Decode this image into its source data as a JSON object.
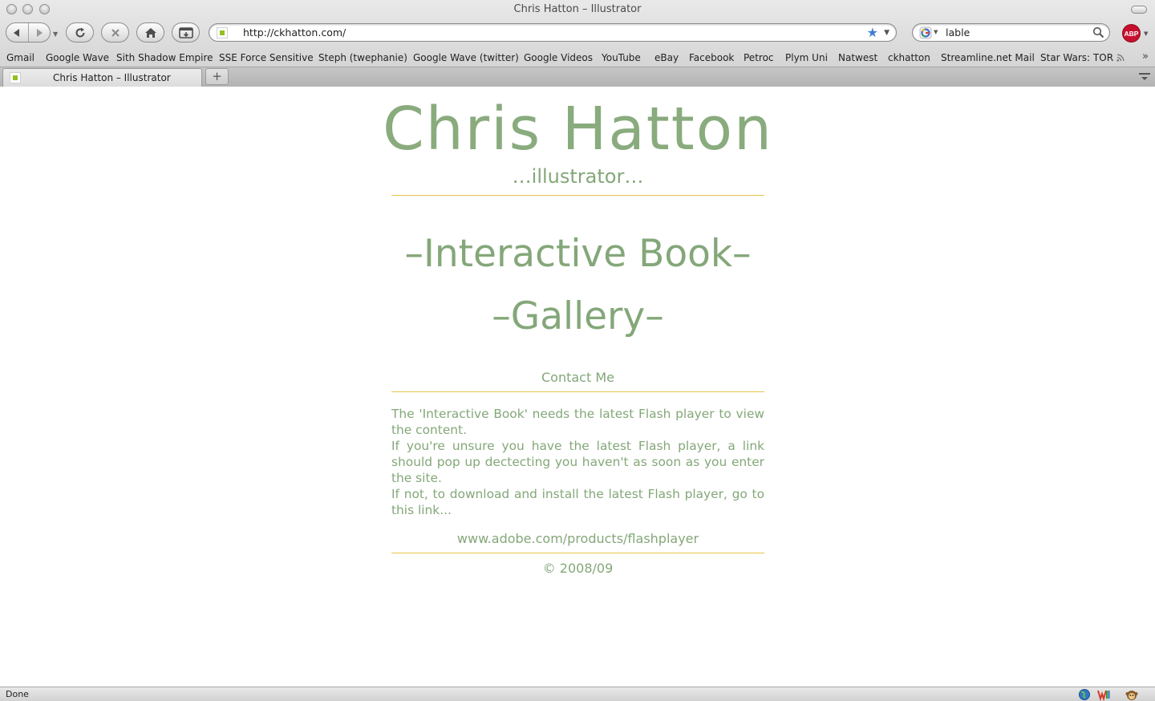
{
  "window": {
    "title": "Chris Hatton – Illustrator"
  },
  "navbar": {
    "url": "http://ckhatton.com/",
    "search_query": "lable"
  },
  "bookmarks": [
    "Gmail",
    "Google Wave",
    "Sith Shadow Empire",
    "SSE Force Sensitive",
    "Steph (twephanie)",
    "Google Wave (twitter)",
    "Google Videos",
    "YouTube",
    "eBay",
    "Facebook",
    "Petroc",
    "Plym Uni",
    "Natwest",
    "ckhatton",
    "Streamline.net Mail",
    "Star Wars: TOR"
  ],
  "tabs": [
    {
      "title": "Chris Hatton – Illustrator",
      "active": true
    }
  ],
  "page": {
    "title": "Chris Hatton",
    "subtitle": "…illustrator…",
    "nav": {
      "interactive_book": "–Interactive Book–",
      "gallery": "–Gallery–",
      "contact": "Contact Me"
    },
    "info": [
      "The 'Interactive Book' needs the latest Flash player to view the content.",
      "If you're unsure you have the latest Flash player, a link should pop up dectecting you haven't as soon as you enter the site.",
      "If not, to download and install the latest Flash player, go to this link..."
    ],
    "flash_link": "www.adobe.com/products/flashplayer",
    "copyright": "© 2008/09"
  },
  "status": {
    "text": "Done"
  },
  "colors": {
    "text_green": "#84a779",
    "title_green": "#89ab7d",
    "rule_yellow": "#e8c64a",
    "star_blue": "#3f7ed6",
    "abp_red": "#c8102e",
    "favicon_green": "#93c01f"
  },
  "icons": {
    "back": "back-arrow-icon",
    "forward": "forward-arrow-icon",
    "reload": "reload-icon",
    "stop": "stop-icon",
    "home": "home-icon",
    "cache": "cache-icon",
    "bookmark": "star-icon",
    "search": "magnifier-icon",
    "adblock": "adblock-plus-icon"
  }
}
